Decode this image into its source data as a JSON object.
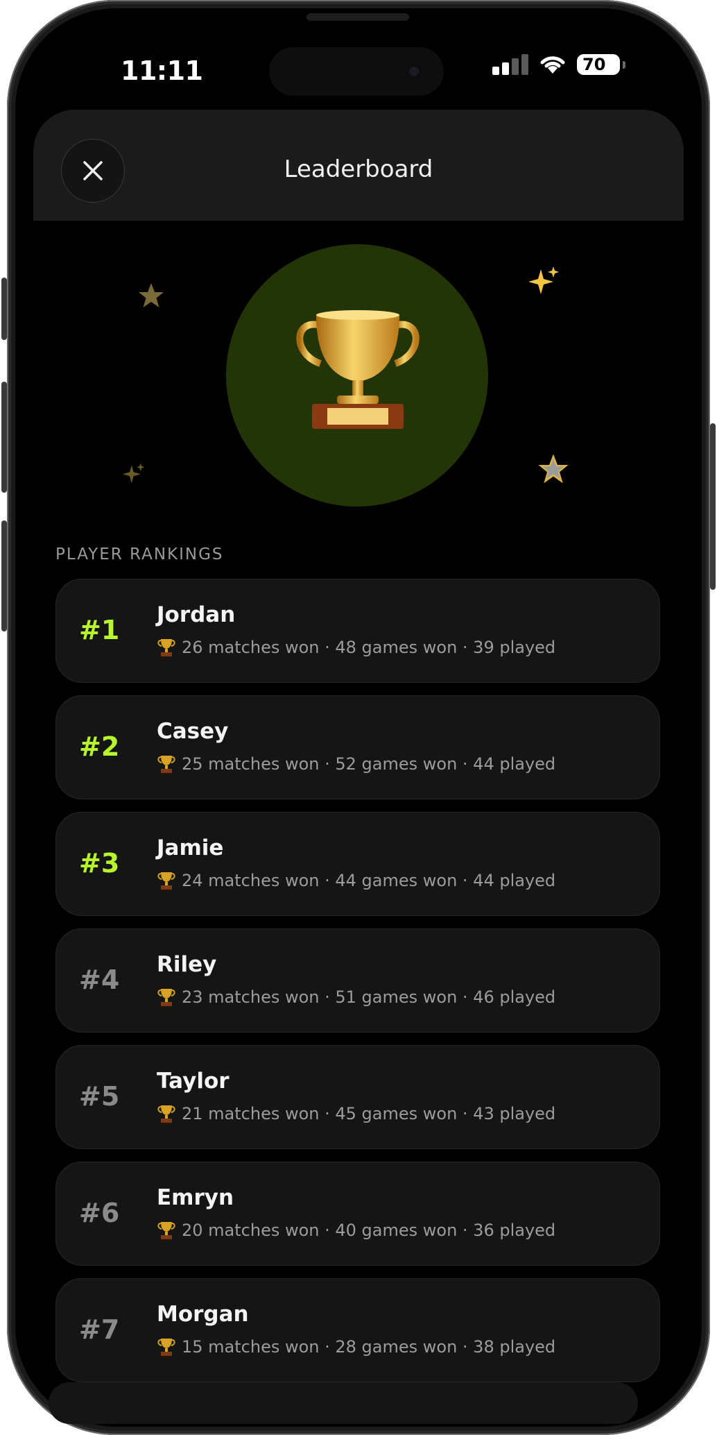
{
  "status_bar": {
    "time": "11:11",
    "battery": "70"
  },
  "header": {
    "title": "Leaderboard"
  },
  "section": {
    "label": "PLAYER RANKINGS"
  },
  "colors": {
    "accent": "#b7f52c",
    "hero_circle": "#233506",
    "card": "#151515"
  },
  "icons": {
    "close": "close-icon",
    "trophy": "trophy-icon",
    "star": "star-icon",
    "sparkles": "sparkles-icon"
  },
  "players": [
    {
      "rank": "#1",
      "name": "Jordan",
      "stats": "26 matches won · 48 games won · 39 played"
    },
    {
      "rank": "#2",
      "name": "Casey",
      "stats": "25 matches won · 52 games won · 44 played"
    },
    {
      "rank": "#3",
      "name": "Jamie",
      "stats": "24 matches won · 44 games won · 44 played"
    },
    {
      "rank": "#4",
      "name": "Riley",
      "stats": "23 matches won · 51 games won · 46 played"
    },
    {
      "rank": "#5",
      "name": "Taylor",
      "stats": "21 matches won · 45 games won · 43 played"
    },
    {
      "rank": "#6",
      "name": "Emryn",
      "stats": "20 matches won · 40 games won · 36 played"
    },
    {
      "rank": "#7",
      "name": "Morgan",
      "stats": "15 matches won · 28 games won · 38 played"
    }
  ]
}
